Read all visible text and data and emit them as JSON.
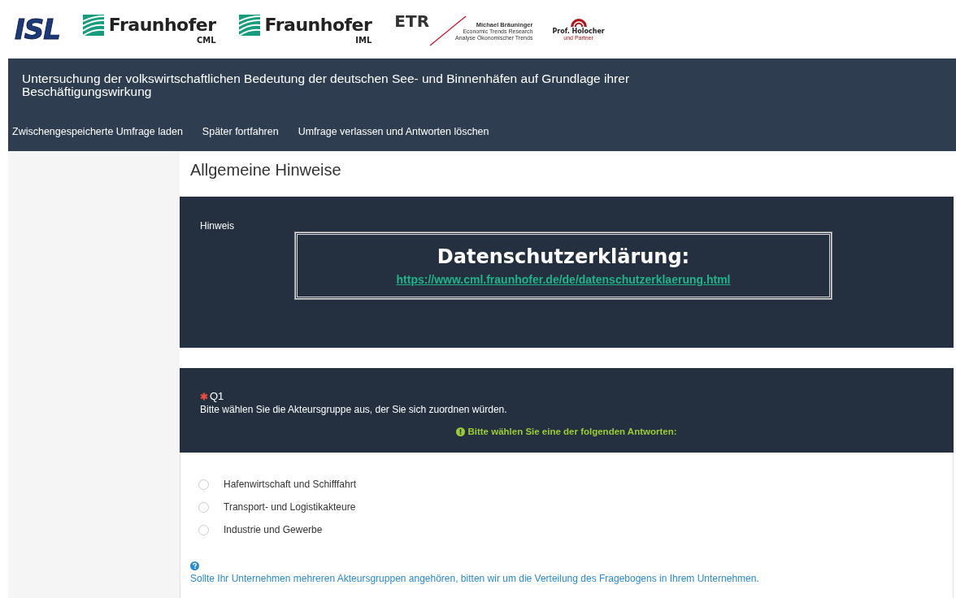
{
  "logos": [
    {
      "kind": "isl",
      "text": "ISL"
    },
    {
      "kind": "fraunhofer",
      "text": "Fraunhofer",
      "sub": "CML"
    },
    {
      "kind": "fraunhofer",
      "text": "Fraunhofer",
      "sub": "IML"
    },
    {
      "kind": "etr",
      "text": "ETR",
      "lines": [
        "Michael Bräuninger",
        "Economic Trends Research",
        "Analyse Ökonomischer Trends"
      ]
    },
    {
      "kind": "holocher",
      "text": "Prof. Holocher",
      "sub": "und Partner"
    }
  ],
  "header": {
    "title": "Untersuchung der volkswirtschaftlichen Bedeutung der deutschen See- und Binnenhäfen auf Grundlage ihrer Beschäftigungswirkung",
    "nav": [
      "Zwischengespeicherte Umfrage laden",
      "Später fortfahren",
      "Umfrage verlassen und Antworten löschen"
    ]
  },
  "group_title": "Allgemeine Hinweise",
  "notice": {
    "label": "Hinweis",
    "heading": "Datenschutzerklärung:",
    "link": "https://www.cml.fraunhofer.de/de/datenschutzerklaerung.html"
  },
  "question": {
    "mandatory": true,
    "code": "Q1",
    "text": "Bitte wählen Sie die Akteursgruppe aus, der Sie sich zuordnen würden.",
    "tip": "Bitte wählen Sie eine der folgenden Antworten:",
    "options": [
      {
        "label": "Hafenwirtschaft und Schifffahrt",
        "selected": false
      },
      {
        "label": "Transport- und Logistikakteure",
        "selected": false
      },
      {
        "label": "Industrie und Gewerbe",
        "selected": false
      }
    ],
    "help": "Sollte Ihr Unternehmen mehreren Akteursgruppen angehören, bitten wir um die Verteilung des Fragebogens in Ihrem Unternehmen."
  }
}
